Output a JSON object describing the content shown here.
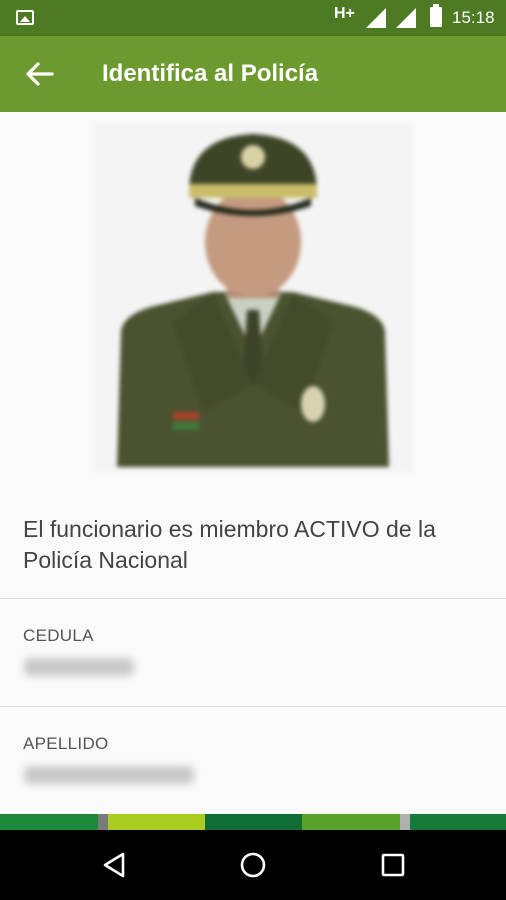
{
  "status_bar": {
    "network_type": "H+",
    "time": "15:18",
    "icons": [
      "gallery-icon",
      "signal-icon",
      "signal-icon",
      "battery-icon"
    ]
  },
  "app_bar": {
    "title": "Identifica al Policía",
    "back_icon": "arrow-left-icon"
  },
  "profile": {
    "photo": "officer-photo (blurred)",
    "status_message": "El funcionario es miembro ACTIVO de la Policía Nacional",
    "fields": [
      {
        "label": "CEDULA"
      },
      {
        "label": "APELLIDO"
      }
    ]
  },
  "footer_stripe": {
    "colors": [
      "#1a8a3a",
      "#7a7a7a",
      "#a9cc1f",
      "#0e6e34",
      "#58a22a",
      "#b0b0b0",
      "#137a38"
    ]
  },
  "nav_bar": {
    "icons": [
      "nav-back-icon",
      "nav-home-icon",
      "nav-recents-icon"
    ]
  },
  "colors": {
    "status_bar": "#4d7a22",
    "app_bar": "#6c9a2e",
    "uniform": "#4a5230"
  }
}
